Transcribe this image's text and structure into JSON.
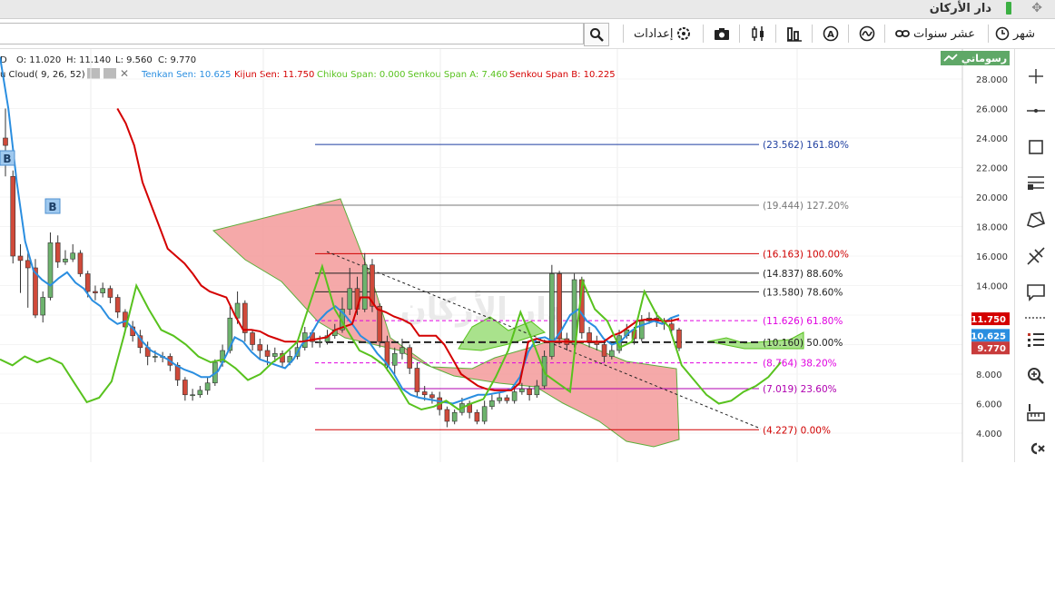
{
  "window": {
    "title": "دار الأركان"
  },
  "toolbar": {
    "settings_label": "إعدادات",
    "period_decade": "عشر سنوات",
    "period_month": "شهر"
  },
  "panel_tab": {
    "label": "رسوماتي"
  },
  "legend": {
    "ohlc": {
      "o": "O: 11.020",
      "h": "H: 11.140",
      "l": "L: 9.560",
      "c": "C: 9.770",
      "d": "D"
    },
    "ichimoku": "u Cloud( 9, 26, 52)",
    "tenkan": "Tenkan Sen: 10.625",
    "kijun": "Kijun Sen: 11.750",
    "chikou": "Chikou Span: 0.000",
    "senkou_a": "Senkou Span A: 7.460",
    "senkou_b": "Senkou Span B: 10.225"
  },
  "watermark": "دار الأركان",
  "signals": [
    "B",
    "B"
  ],
  "price_badges": [
    {
      "text": "11.750",
      "value": 11.75,
      "color": "#d40000"
    },
    {
      "text": "10.625",
      "value": 10.625,
      "color": "#2a8ee0"
    },
    {
      "text": "9.770",
      "value": 9.77,
      "color": "#c83c3c"
    }
  ],
  "chart_data": {
    "type": "candlestick",
    "ylim": [
      3,
      29.5
    ],
    "y_ticks": [
      "4.000",
      "6.000",
      "8.000",
      "10.000",
      "12.000",
      "14.000",
      "16.000",
      "18.000",
      "20.000",
      "22.000",
      "24.000",
      "26.000",
      "28.000"
    ],
    "fib_levels": [
      {
        "price": 23.562,
        "label": "(23.562) 161.80%",
        "color": "#1f3fa0"
      },
      {
        "price": 19.444,
        "label": "(19.444) 127.20%",
        "color": "#777777"
      },
      {
        "price": 16.163,
        "label": "(16.163) 100.00%",
        "color": "#d00000"
      },
      {
        "price": 14.837,
        "label": "(14.837) 88.60%",
        "color": "#222222"
      },
      {
        "price": 13.58,
        "label": "(13.580) 78.60%",
        "color": "#222222"
      },
      {
        "price": 11.626,
        "label": "(11.626) 61.80%",
        "color": "#e000e0"
      },
      {
        "price": 10.16,
        "label": "(10.160) 50.00%",
        "color": "#222222"
      },
      {
        "price": 8.764,
        "label": "(8.764) 38.20%",
        "color": "#e000e0"
      },
      {
        "price": 7.019,
        "label": "(7.019) 23.60%",
        "color": "#b000b0"
      },
      {
        "price": 4.227,
        "label": "(4.227) 0.00%",
        "color": "#d00000"
      }
    ],
    "series": [
      {
        "name": "Tenkan Sen",
        "color": "#2a8ee0",
        "values": [
          29.5,
          26,
          21,
          17,
          15,
          14.4,
          14,
          14.5,
          14.9,
          14.2,
          13.8,
          13,
          12.6,
          11.8,
          11.4,
          11.6,
          11,
          10.2,
          9.6,
          9.3,
          9,
          8.6,
          8.3,
          8.1,
          7.8,
          7.8,
          8.2,
          9.3,
          10.5,
          10.2,
          9.5,
          9.0,
          8.8,
          8.6,
          8.4,
          9,
          10,
          10.6,
          11.6,
          12.2,
          12.6,
          12.1,
          11.4,
          10.6,
          10.2,
          9.4,
          8.8,
          8.0,
          7.0,
          6.6,
          6.4,
          6.3,
          6.2,
          6.1,
          6.0,
          6.2,
          6.4,
          6.6,
          6.6,
          6.7,
          6.8,
          7.0,
          7.8,
          9.5,
          10.4,
          10.5,
          10.2,
          11,
          12,
          12.4,
          11.6,
          11.2,
          10.4,
          10.0,
          10.2,
          10.8,
          11.2,
          11.4,
          11.6,
          11.4,
          11.8,
          12.0
        ]
      },
      {
        "name": "Kijun Sen",
        "color": "#d40000",
        "values": [
          null,
          null,
          null,
          null,
          null,
          null,
          null,
          null,
          null,
          null,
          null,
          null,
          null,
          null,
          26,
          25,
          23.5,
          21,
          19.5,
          18,
          16.5,
          16,
          15.5,
          14.8,
          14,
          13.6,
          13.4,
          13.2,
          12,
          11,
          11,
          10.9,
          10.6,
          10.4,
          10.2,
          10.2,
          10.2,
          10.3,
          10.4,
          10.5,
          11.0,
          11.2,
          11.4,
          13.2,
          13.2,
          12.4,
          12.2,
          11.9,
          11.7,
          11.4,
          10.6,
          10.6,
          10.6,
          10.0,
          9.0,
          8.0,
          7.6,
          7.2,
          7.0,
          6.9,
          6.9,
          6.9,
          7.4,
          10.2,
          10.4,
          10.2,
          10.2,
          10.2,
          10.2,
          10.2,
          10.2,
          10.2,
          10.2,
          10.6,
          10.8,
          11.2,
          11.6,
          11.7,
          11.7,
          11.6,
          11.6,
          11.75
        ]
      },
      {
        "name": "Chikou Span",
        "color": "#58c21e",
        "values": [
          9,
          8.6,
          9.2,
          8.8,
          9.1,
          8.7,
          7.4,
          6.1,
          6.4,
          7.5,
          10.6,
          14,
          12.4,
          11,
          10.6,
          10,
          9.2,
          8.8,
          9.0,
          8.4,
          7.6,
          8.0,
          8.8,
          9.4,
          10.2,
          12.8,
          15.3,
          12.4,
          11,
          9.6,
          9.2,
          8.6,
          7.4,
          6.0,
          5.6,
          5.8,
          6.2,
          5.6,
          6.0,
          6.3,
          7.8,
          9.6,
          12.2,
          10.2,
          8.0,
          7.4,
          6.8,
          14.3,
          12.4,
          11.6,
          9.8,
          10.2,
          13.6,
          12.0,
          11.2,
          8.6,
          7.6,
          6.6,
          6.0,
          6.2,
          6.8,
          7.2,
          7.8,
          8.8
        ]
      }
    ],
    "cloud_a": [],
    "cloud_b": [],
    "candles": [
      [
        24.0,
        23.5,
        26.0,
        21.4
      ],
      [
        21.4,
        16.0,
        21.8,
        15.5
      ],
      [
        16.0,
        15.7,
        16.8,
        13.5
      ],
      [
        15.7,
        15.2,
        16.2,
        12.5
      ],
      [
        15.2,
        12.0,
        15.8,
        11.8
      ],
      [
        12.0,
        13.2,
        13.6,
        11.5
      ],
      [
        13.2,
        16.9,
        17.6,
        13.0
      ],
      [
        16.9,
        15.6,
        17.4,
        15.2
      ],
      [
        15.6,
        15.8,
        16.4,
        15.4
      ],
      [
        15.8,
        16.2,
        16.8,
        15.6
      ],
      [
        16.2,
        14.8,
        16.4,
        14.6
      ],
      [
        14.8,
        13.6,
        15.0,
        13.2
      ],
      [
        13.6,
        13.5,
        14.0,
        13.0
      ],
      [
        13.5,
        13.8,
        14.2,
        13.2
      ],
      [
        13.8,
        13.2,
        14.0,
        12.8
      ],
      [
        13.2,
        12.2,
        13.4,
        11.8
      ],
      [
        12.2,
        11.2,
        12.4,
        10.8
      ],
      [
        11.2,
        10.6,
        11.6,
        10.2
      ],
      [
        10.6,
        9.8,
        11.0,
        9.4
      ],
      [
        9.8,
        9.2,
        10.2,
        8.6
      ],
      [
        9.2,
        9.2,
        9.6,
        8.8
      ],
      [
        9.2,
        9.2,
        9.5,
        8.8
      ],
      [
        9.2,
        8.6,
        9.4,
        8.2
      ],
      [
        8.6,
        7.6,
        8.8,
        7.2
      ],
      [
        7.6,
        6.6,
        7.8,
        6.2
      ],
      [
        6.6,
        6.6,
        7.0,
        6.2
      ],
      [
        6.6,
        6.9,
        7.2,
        6.4
      ],
      [
        6.9,
        7.4,
        7.8,
        6.6
      ],
      [
        7.4,
        8.8,
        9.0,
        7.2
      ],
      [
        8.8,
        9.6,
        10.0,
        8.5
      ],
      [
        9.6,
        11.8,
        12.6,
        9.4
      ],
      [
        11.8,
        12.8,
        13.6,
        11.4
      ],
      [
        12.8,
        10.8,
        13.0,
        10.2
      ],
      [
        10.8,
        10.0,
        11.0,
        9.6
      ],
      [
        10.0,
        9.6,
        10.4,
        9.0
      ],
      [
        9.6,
        9.2,
        10.0,
        8.6
      ],
      [
        9.2,
        9.4,
        9.8,
        8.8
      ],
      [
        9.4,
        8.8,
        9.6,
        8.4
      ],
      [
        8.8,
        9.2,
        9.6,
        8.6
      ],
      [
        9.2,
        9.8,
        10.2,
        9.0
      ],
      [
        9.8,
        10.8,
        11.2,
        9.6
      ],
      [
        10.8,
        10.2,
        11.0,
        9.8
      ],
      [
        10.2,
        10.2,
        10.6,
        9.8
      ],
      [
        10.2,
        10.6,
        11.0,
        10.0
      ],
      [
        10.6,
        11.0,
        11.4,
        10.4
      ],
      [
        11.0,
        12.4,
        13.2,
        10.8
      ],
      [
        12.4,
        13.8,
        15.2,
        12.0
      ],
      [
        13.8,
        12.4,
        14.6,
        12.0
      ],
      [
        12.4,
        15.4,
        16.2,
        12.2
      ],
      [
        15.4,
        12.6,
        15.8,
        12.2
      ],
      [
        12.6,
        10.2,
        12.8,
        9.8
      ],
      [
        10.2,
        8.6,
        10.6,
        8.2
      ],
      [
        8.6,
        9.4,
        9.8,
        8.0
      ],
      [
        9.4,
        9.8,
        10.4,
        9.0
      ],
      [
        9.8,
        8.4,
        10.0,
        8.0
      ],
      [
        8.4,
        6.8,
        8.8,
        6.4
      ],
      [
        6.8,
        6.6,
        7.2,
        6.2
      ],
      [
        6.6,
        6.4,
        6.8,
        6.0
      ],
      [
        6.4,
        5.6,
        6.8,
        5.2
      ],
      [
        5.6,
        4.8,
        5.8,
        4.4
      ],
      [
        4.8,
        5.4,
        5.6,
        4.6
      ],
      [
        5.4,
        6.0,
        6.4,
        5.2
      ],
      [
        6.0,
        5.4,
        6.2,
        5.0
      ],
      [
        5.4,
        4.8,
        5.6,
        4.6
      ],
      [
        4.8,
        5.8,
        6.2,
        4.6
      ],
      [
        5.8,
        6.2,
        6.6,
        5.6
      ],
      [
        6.2,
        6.4,
        6.8,
        6.0
      ],
      [
        6.4,
        6.2,
        6.6,
        6.0
      ],
      [
        6.2,
        6.8,
        7.2,
        6.0
      ],
      [
        6.8,
        7.0,
        7.4,
        6.6
      ],
      [
        7.0,
        6.6,
        7.2,
        6.2
      ],
      [
        6.6,
        7.2,
        7.6,
        6.4
      ],
      [
        7.2,
        9.2,
        9.6,
        7.0
      ],
      [
        9.2,
        14.8,
        15.4,
        9.0
      ],
      [
        14.8,
        10.4,
        15.0,
        10.0
      ],
      [
        10.4,
        10.0,
        10.8,
        9.6
      ],
      [
        10.0,
        14.4,
        14.8,
        9.8
      ],
      [
        14.4,
        10.8,
        14.6,
        10.4
      ],
      [
        10.8,
        10.2,
        11.2,
        9.8
      ],
      [
        10.2,
        10.0,
        10.6,
        9.6
      ],
      [
        10.0,
        9.2,
        10.4,
        8.8
      ],
      [
        9.2,
        9.6,
        10.0,
        9.0
      ],
      [
        9.6,
        10.6,
        11.0,
        9.4
      ],
      [
        10.6,
        11.0,
        11.4,
        10.4
      ],
      [
        11.0,
        10.4,
        11.2,
        10.0
      ],
      [
        10.4,
        11.6,
        12.0,
        10.2
      ],
      [
        11.6,
        11.8,
        12.2,
        11.4
      ],
      [
        11.8,
        11.6,
        12.2,
        11.2
      ],
      [
        11.6,
        11.4,
        11.8,
        11.0
      ],
      [
        11.4,
        11.0,
        11.8,
        10.6
      ],
      [
        11.0,
        9.77,
        11.14,
        9.56
      ]
    ]
  }
}
